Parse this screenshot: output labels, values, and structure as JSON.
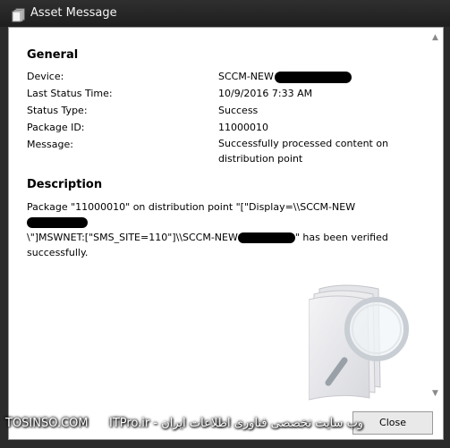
{
  "window": {
    "title": "Asset Message",
    "icon": "asset-message-icon"
  },
  "general": {
    "heading": "General",
    "rows": [
      {
        "label": "Device:",
        "value": "SCCM-NEW"
      },
      {
        "label": "Last Status Time:",
        "value": "10/9/2016 7:33 AM"
      },
      {
        "label": "Status Type:",
        "value": "Success"
      },
      {
        "label": "Package ID:",
        "value": "11000010"
      },
      {
        "label": "Message:",
        "value": "Successfully processed content on distribution point"
      }
    ]
  },
  "description": {
    "heading": "Description",
    "part1": "Package \"11000010\" on distribution point \"[\"Display=\\\\SCCM-NEW",
    "part2": "\\\"]MSWNET:[\"SMS_SITE=110\"]\\\\SCCM-NEW",
    "part3": "\" has been verified successfully."
  },
  "close_label": "Close",
  "watermark": {
    "left": "TOSINSO.COM",
    "right": "وب سایت تخصصی فناوری اطلاعات ایران - ITPro.ir"
  }
}
